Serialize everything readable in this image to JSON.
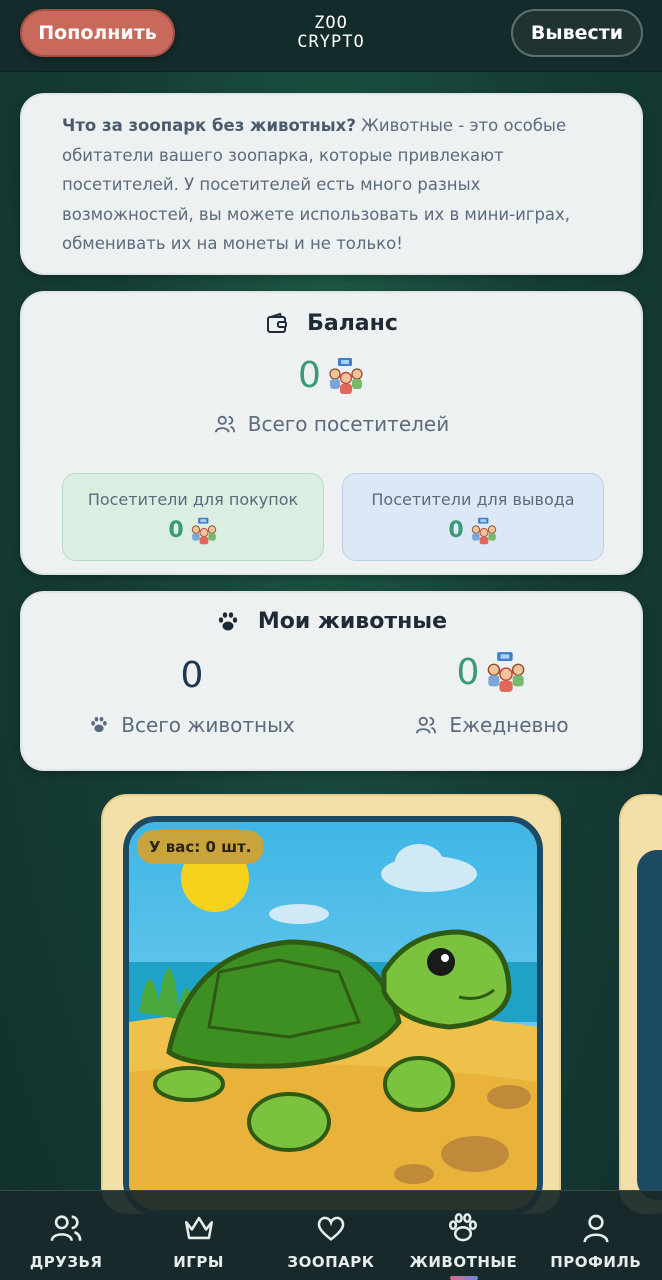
{
  "header": {
    "topup_label": "Пополнить",
    "logo_line1": "ZOO",
    "logo_line2": "CRYPTO",
    "withdraw_label": "Вывести"
  },
  "info": {
    "bold": "Что за зоопарк без животных?",
    "text": " Животные - это особые обитатели вашего зоопарка, которые привлекают посетителей. У посетителей есть много разных возможностей, вы можете использовать их в мини-играх, обменивать их на монеты и не только!"
  },
  "balance": {
    "title": "Баланс",
    "total_value": "0",
    "total_label": "Всего посетителей",
    "buy_label": "Посетители для покупок",
    "buy_value": "0",
    "withdraw_label": "Посетители для вывода",
    "withdraw_value": "0"
  },
  "my_animals": {
    "title": "Мои животные",
    "total_value": "0",
    "total_label": "Всего животных",
    "daily_value": "0",
    "daily_label": "Ежедневно"
  },
  "animal_card": {
    "owned_label": "У вас: 0 шт."
  },
  "nav": {
    "items": [
      {
        "label": "ДРУЗЬЯ",
        "icon": "users-icon"
      },
      {
        "label": "ИГРЫ",
        "icon": "crown-icon"
      },
      {
        "label": "ЗООПАРК",
        "icon": "heart-icon"
      },
      {
        "label": "ЖИВОТНЫЕ",
        "icon": "paw-icon",
        "active": true
      },
      {
        "label": "ПРОФИЛЬ",
        "icon": "user-icon"
      }
    ]
  },
  "colors": {
    "accent_green": "#3a9a75",
    "topup_red": "#c9695c",
    "background": "#163f36"
  }
}
